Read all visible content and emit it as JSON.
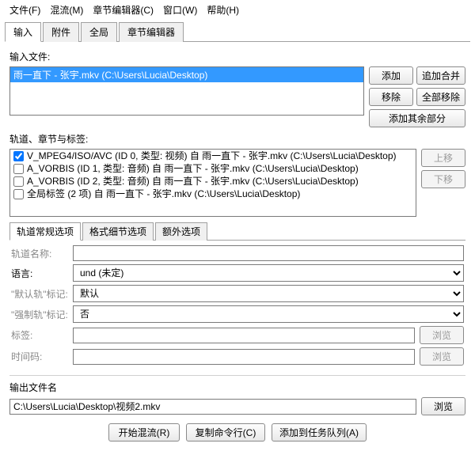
{
  "menu": {
    "file": "文件(F)",
    "mux": "混流(M)",
    "chapter_editor": "章节编辑器(C)",
    "window": "窗口(W)",
    "help": "帮助(H)"
  },
  "tabs": {
    "input": "输入",
    "attachments": "附件",
    "global": "全局",
    "chapters": "章节编辑器"
  },
  "input_files": {
    "label": "输入文件:",
    "items": [
      "雨一直下 - 张宇.mkv  (C:\\Users\\Lucia\\Desktop)"
    ],
    "buttons": {
      "add": "添加",
      "append": "追加合并",
      "remove": "移除",
      "remove_all": "全部移除",
      "add_rest": "添加其余部分"
    }
  },
  "tracks": {
    "label": "轨道、章节与标签:",
    "rows": [
      {
        "checked": true,
        "text": "V_MPEG4/ISO/AVC (ID 0, 类型: 视频) 自 雨一直下 - 张宇.mkv (C:\\Users\\Lucia\\Desktop)"
      },
      {
        "checked": false,
        "text": "A_VORBIS (ID 1, 类型: 音频) 自 雨一直下 - 张宇.mkv (C:\\Users\\Lucia\\Desktop)"
      },
      {
        "checked": false,
        "text": "A_VORBIS (ID 2, 类型: 音频) 自 雨一直下 - 张宇.mkv (C:\\Users\\Lucia\\Desktop)"
      },
      {
        "checked": false,
        "text": "全局标签 (2 项) 自 雨一直下 - 张宇.mkv (C:\\Users\\Lucia\\Desktop)"
      }
    ],
    "buttons": {
      "up": "上移",
      "down": "下移"
    }
  },
  "inner_tabs": {
    "general": "轨道常规选项",
    "format": "格式细节选项",
    "extra": "额外选项"
  },
  "form": {
    "track_name": {
      "label": "轨道名称:",
      "value": ""
    },
    "language": {
      "label": "语言:",
      "value": "und (未定)"
    },
    "default": {
      "label": "\"默认轨\"标记:",
      "value": "默认"
    },
    "forced": {
      "label": "\"强制轨\"标记:",
      "value": "否"
    },
    "tags": {
      "label": "标签:",
      "value": "",
      "browse": "浏览"
    },
    "timecodes": {
      "label": "时间码:",
      "value": "",
      "browse": "浏览"
    }
  },
  "output": {
    "label": "输出文件名",
    "value": "C:\\Users\\Lucia\\Desktop\\视频2.mkv",
    "browse": "浏览"
  },
  "bottom": {
    "start": "开始混流(R)",
    "copycli": "复制命令行(C)",
    "addqueue": "添加到任务队列(A)"
  }
}
